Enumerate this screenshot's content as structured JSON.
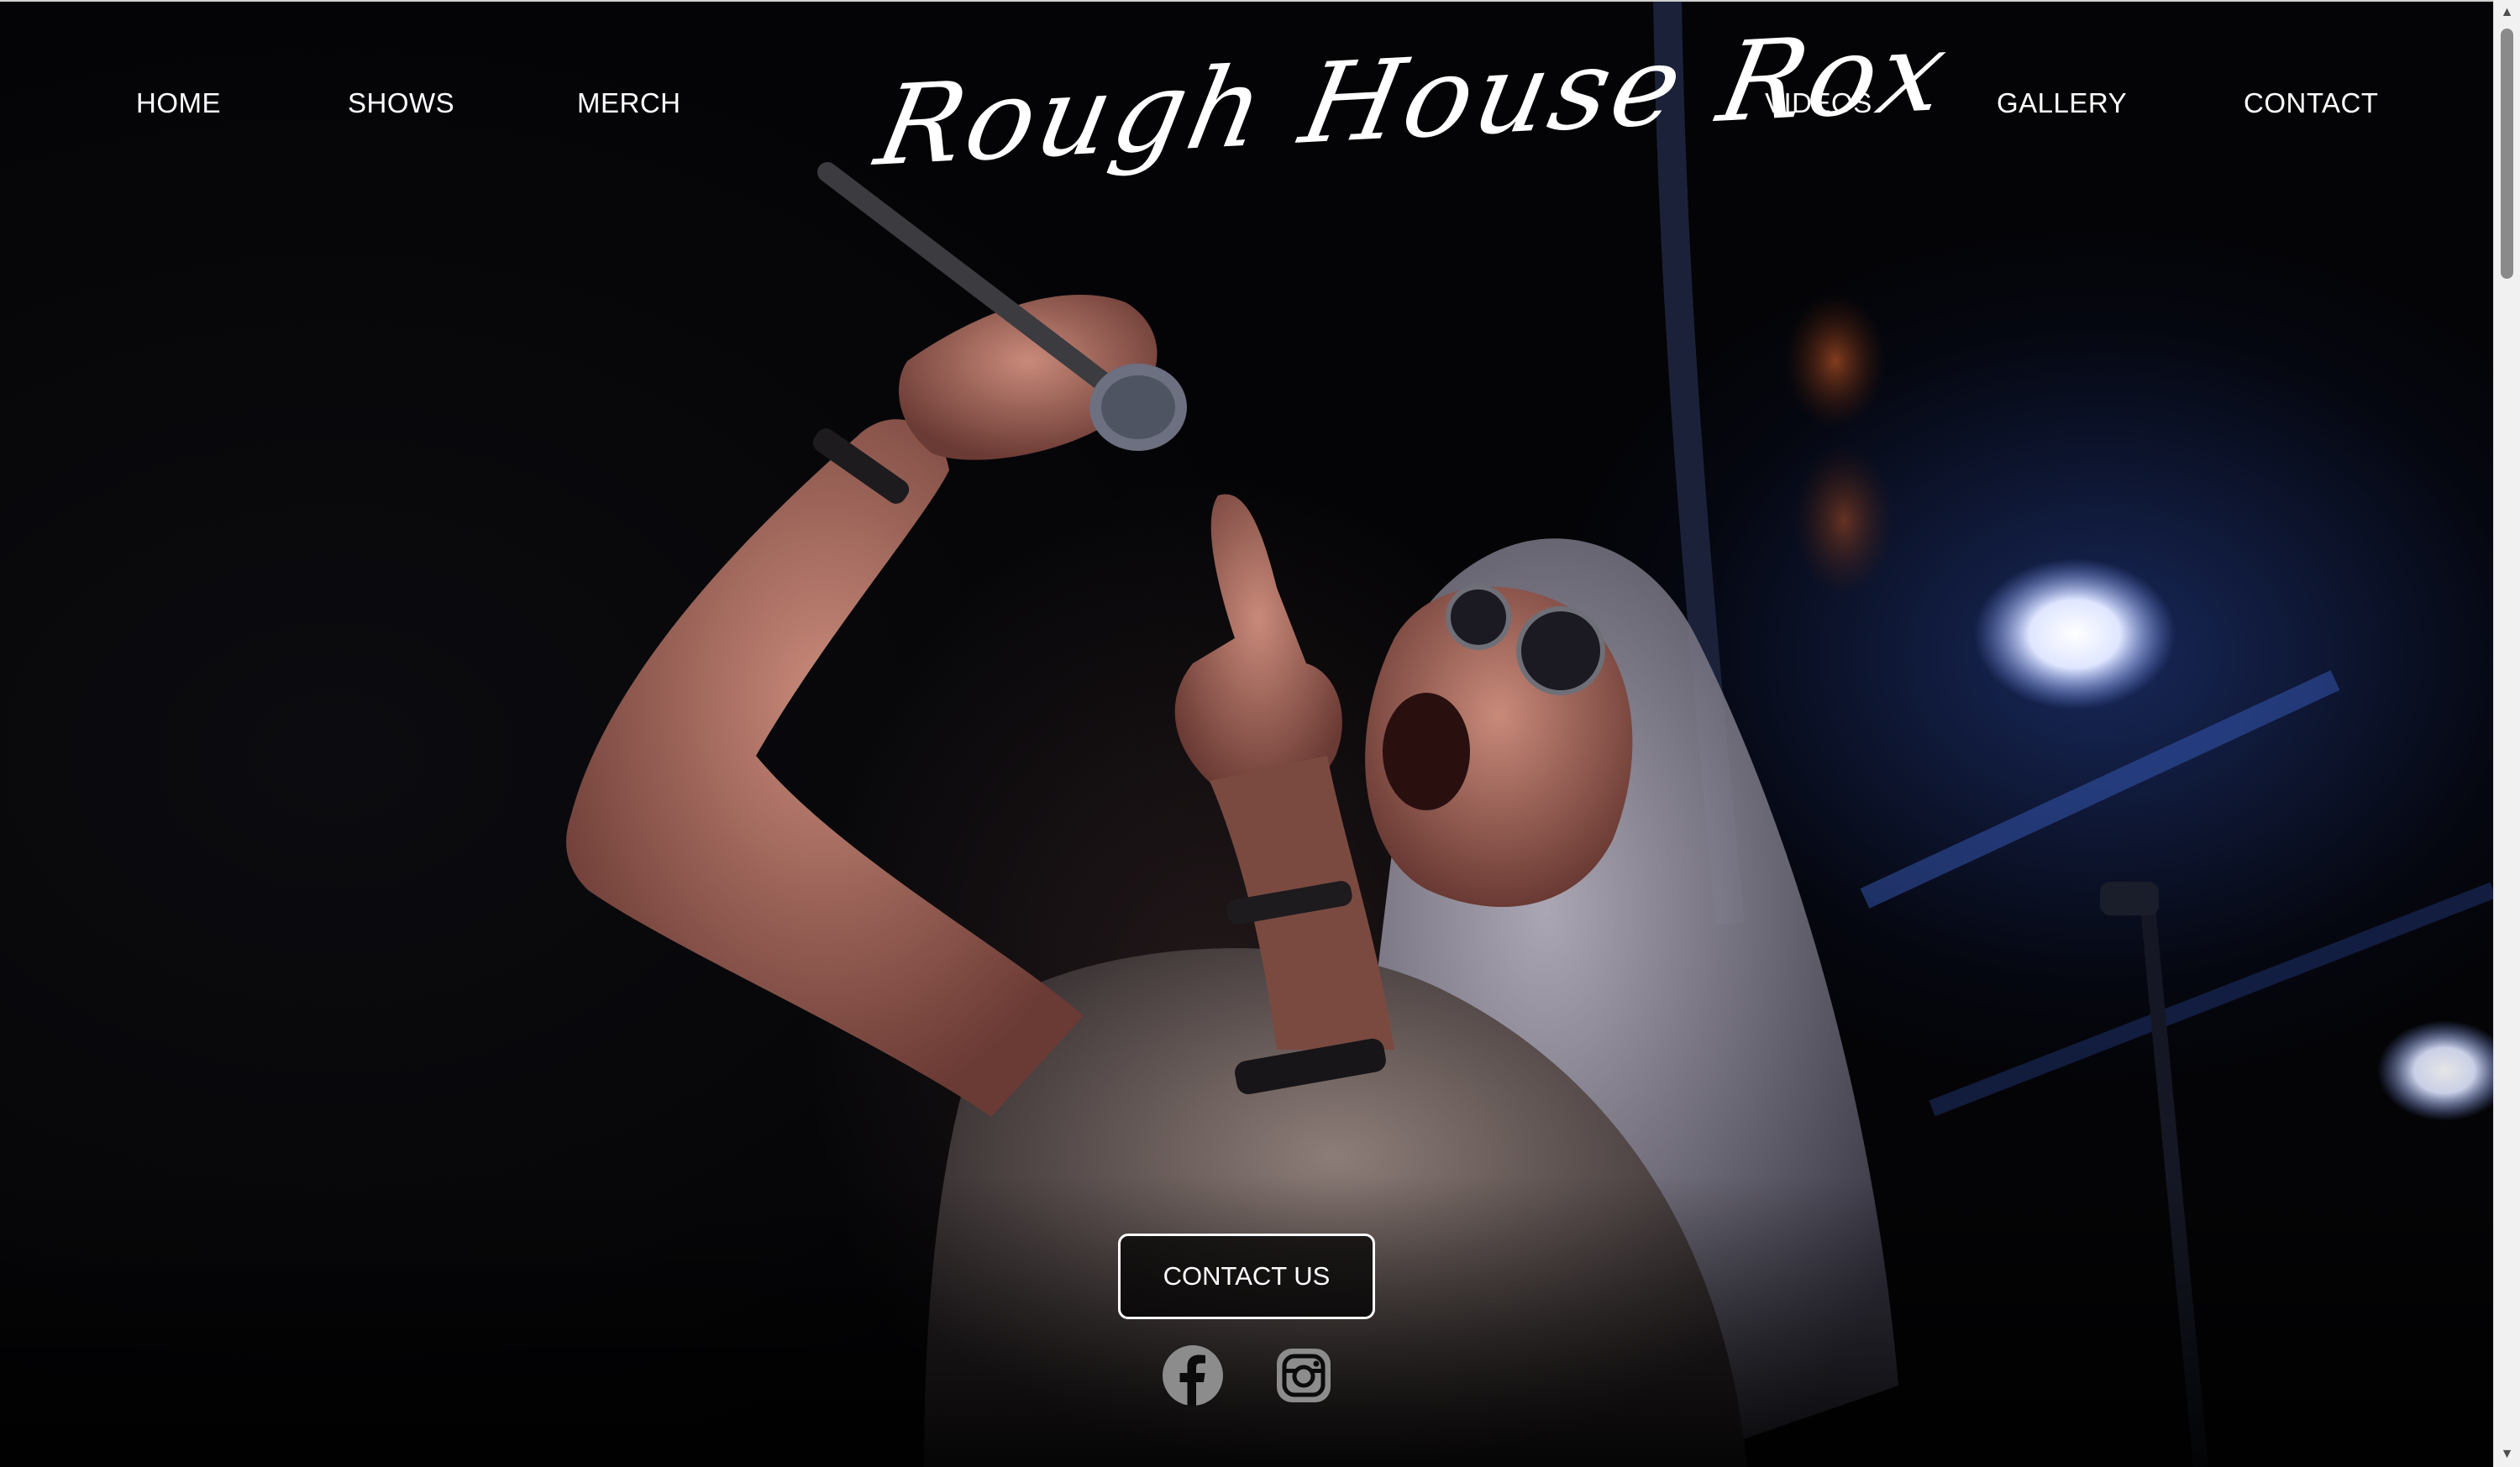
{
  "nav": {
    "left": [
      {
        "label": "HOME"
      },
      {
        "label": "SHOWS"
      },
      {
        "label": "MERCH"
      }
    ],
    "right": [
      {
        "label": "VIDEOS"
      },
      {
        "label": "GALLERY"
      },
      {
        "label": "CONTACT"
      }
    ],
    "logo": "Rough House Rox"
  },
  "hero": {
    "cta_label": "CONTACT US",
    "social": [
      {
        "icon": "facebook-icon"
      },
      {
        "icon": "instagram-icon"
      }
    ],
    "image_subject": "singer-with-microphone"
  },
  "colors": {
    "background": "#000000",
    "text": "#ffffff",
    "stage_light": "#2f5bd0",
    "social_icon": "#8c8c8c"
  }
}
